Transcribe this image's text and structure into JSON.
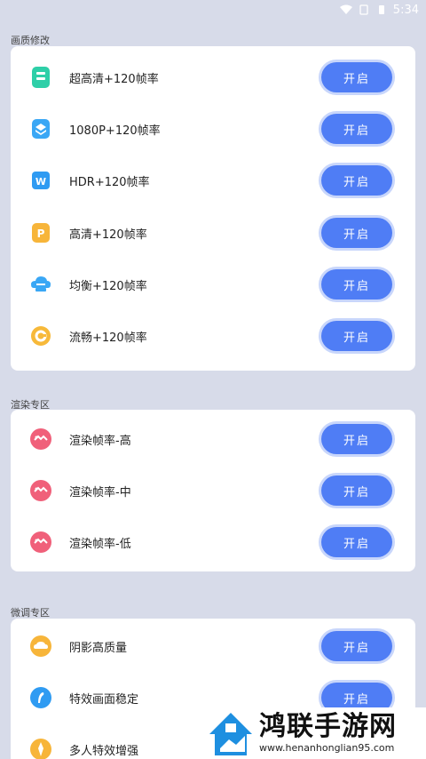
{
  "status_bar": {
    "time": "5:34"
  },
  "sections": [
    {
      "title": "画质修改",
      "items": [
        {
          "label": "超高清+120帧率",
          "button": "开启",
          "icon": "ultra-hd-icon",
          "color": "#2ecfa8"
        },
        {
          "label": "1080P+120帧率",
          "button": "开启",
          "icon": "layers-icon",
          "color": "#3aa7f5"
        },
        {
          "label": "HDR+120帧率",
          "button": "开启",
          "icon": "hdr-icon",
          "color": "#2f9bf2"
        },
        {
          "label": "高清+120帧率",
          "button": "开启",
          "icon": "hd-icon",
          "color": "#f7b53a"
        },
        {
          "label": "均衡+120帧率",
          "button": "开启",
          "icon": "cloud-icon",
          "color": "#3aa7f5"
        },
        {
          "label": "流畅+120帧率",
          "button": "开启",
          "icon": "smooth-icon",
          "color": "#f7b93a"
        }
      ]
    },
    {
      "title": "渲染专区",
      "items": [
        {
          "label": "渲染帧率-高",
          "button": "开启",
          "icon": "render-icon",
          "color": "#f0607a"
        },
        {
          "label": "渲染帧率-中",
          "button": "开启",
          "icon": "render-icon",
          "color": "#f0607a"
        },
        {
          "label": "渲染帧率-低",
          "button": "开启",
          "icon": "render-icon",
          "color": "#f0607a"
        }
      ]
    },
    {
      "title": "微调专区",
      "items": [
        {
          "label": "阴影高质量",
          "button": "开启",
          "icon": "shadow-cloud-icon",
          "color": "#f7b53a"
        },
        {
          "label": "特效画面稳定",
          "button": "开启",
          "icon": "effect-icon",
          "color": "#2f9bf2"
        },
        {
          "label": "多人特效增强",
          "button": "开启",
          "icon": "multi-effect-icon",
          "color": "#f7b53a"
        }
      ]
    }
  ],
  "watermark": {
    "title": "鸿联手游网",
    "subtitle": "www.henanhonglian95.com"
  },
  "colors": {
    "background": "#d7dbe9",
    "button": "#4f7df5",
    "card": "#ffffff"
  }
}
